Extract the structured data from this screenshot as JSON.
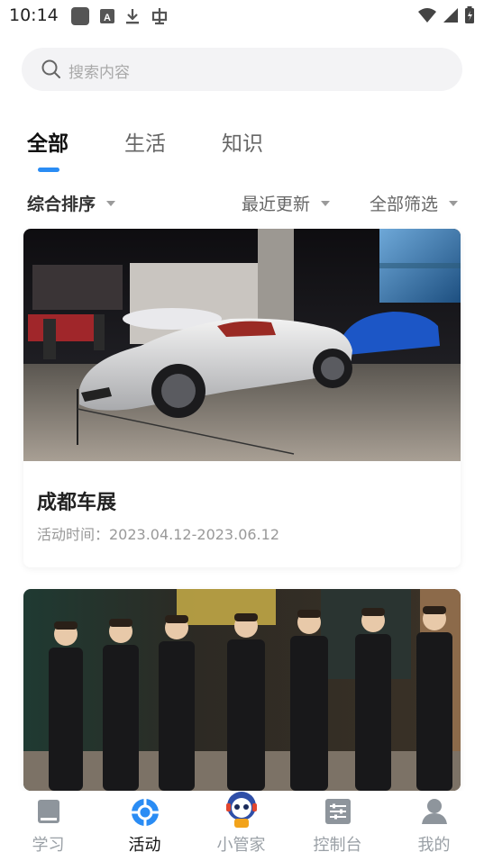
{
  "status_bar": {
    "time": "10:14"
  },
  "search": {
    "placeholder": "搜索内容"
  },
  "tabs": [
    {
      "label": "全部",
      "active": true
    },
    {
      "label": "生活",
      "active": false
    },
    {
      "label": "知识",
      "active": false
    }
  ],
  "filters": {
    "sort": "综合排序",
    "recent": "最近更新",
    "all": "全部筛选"
  },
  "cards": [
    {
      "title": "成都车展",
      "date": "活动时间：2023.04.12-2023.06.12"
    },
    {
      "title": "",
      "date": ""
    }
  ],
  "bottom_nav": [
    {
      "label": "学习",
      "icon": "book-icon"
    },
    {
      "label": "活动",
      "icon": "activity-icon",
      "active": true
    },
    {
      "label": "小管家",
      "icon": "robot-mascot-icon"
    },
    {
      "label": "控制台",
      "icon": "sliders-icon"
    },
    {
      "label": "我的",
      "icon": "user-icon"
    }
  ],
  "colors": {
    "accent": "#2a8cf4",
    "inactive": "#9aa0a6"
  }
}
